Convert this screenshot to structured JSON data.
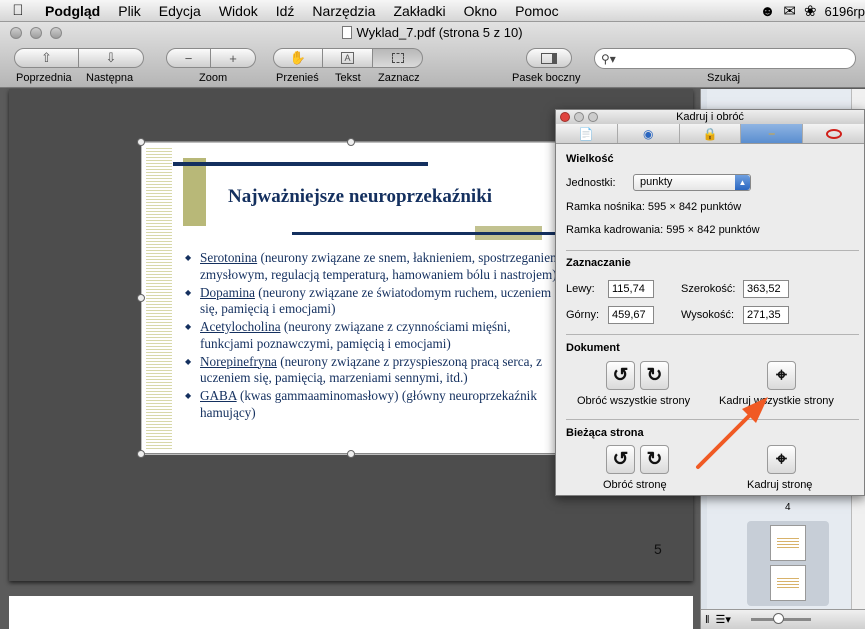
{
  "menubar": {
    "apple": "",
    "app": "Podgląd",
    "items": [
      "Plik",
      "Edycja",
      "Widok",
      "Idź",
      "Narzędzia",
      "Zakładki",
      "Okno",
      "Pomoc"
    ],
    "user": "6196rp"
  },
  "window": {
    "title": "Wyklad_7.pdf (strona 5 z 10)"
  },
  "toolbar": {
    "prev_label": "Poprzednia",
    "next_label": "Następna",
    "zoom_label": "Zoom",
    "zoom_out": "−",
    "zoom_in": "+",
    "move_label": "Przenieś",
    "text_label": "Tekst",
    "select_label": "Zaznacz",
    "sidebar_label": "Pasek boczny",
    "search_label": "Szukaj",
    "search_value": ""
  },
  "slide": {
    "title": "Najważniejsze neuroprzekaźniki",
    "items": [
      {
        "term": "Serotonina",
        "desc": " (neurony związane ze snem, łaknieniem, spostrzeganiem zmysłowym, regulacją temperaturą, hamowaniem bólu i nastrojem)"
      },
      {
        "term": "Dopamina",
        "desc": " (neurony związane ze światodomym ruchem, uczeniem się, pamięcią i emocjami)"
      },
      {
        "term": "Acetylocholina",
        "desc": " (neurony związane z czynnościami mięśni, funkcjami poznawczymi, pamięcią i emocjami)"
      },
      {
        "term": "Norepinefryna",
        "desc": " (neurony związane z przyspieszoną pracą serca, z uczeniem się, pamięcią, marzeniami sennymi, itd.)"
      },
      {
        "term": "GABA",
        "desc": " (kwas gammaaminomasłowy) (główny neuroprzekaźnik hamujący)"
      }
    ]
  },
  "page": {
    "number": "5"
  },
  "sidebar": {
    "thumb_label": "4"
  },
  "panel": {
    "title": "Kadruj i obróć",
    "size_section": "Wielkość",
    "units_label": "Jednostki:",
    "units_value": "punkty",
    "media_box": "Ramka nośnika: 595 × 842 punktów",
    "crop_box": "Ramka kadrowania: 595 × 842 punktów",
    "selection_section": "Zaznaczanie",
    "left_label": "Lewy:",
    "left_value": "115,74",
    "width_label": "Szerokość:",
    "width_value": "363,52",
    "top_label": "Górny:",
    "top_value": "459,67",
    "height_label": "Wysokość:",
    "height_value": "271,35",
    "document_section": "Dokument",
    "rotate_all": "Obróć wszystkie strony",
    "crop_all": "Kadruj wszystkie strony",
    "current_section": "Bieżąca strona",
    "rotate_page": "Obróć stronę",
    "crop_page": "Kadruj stronę"
  },
  "colors": {
    "slide_accent": "#14305f",
    "slide_olive": "#b8b878",
    "arrow": "#f05a24",
    "active_tab": "#5a8ed0"
  }
}
